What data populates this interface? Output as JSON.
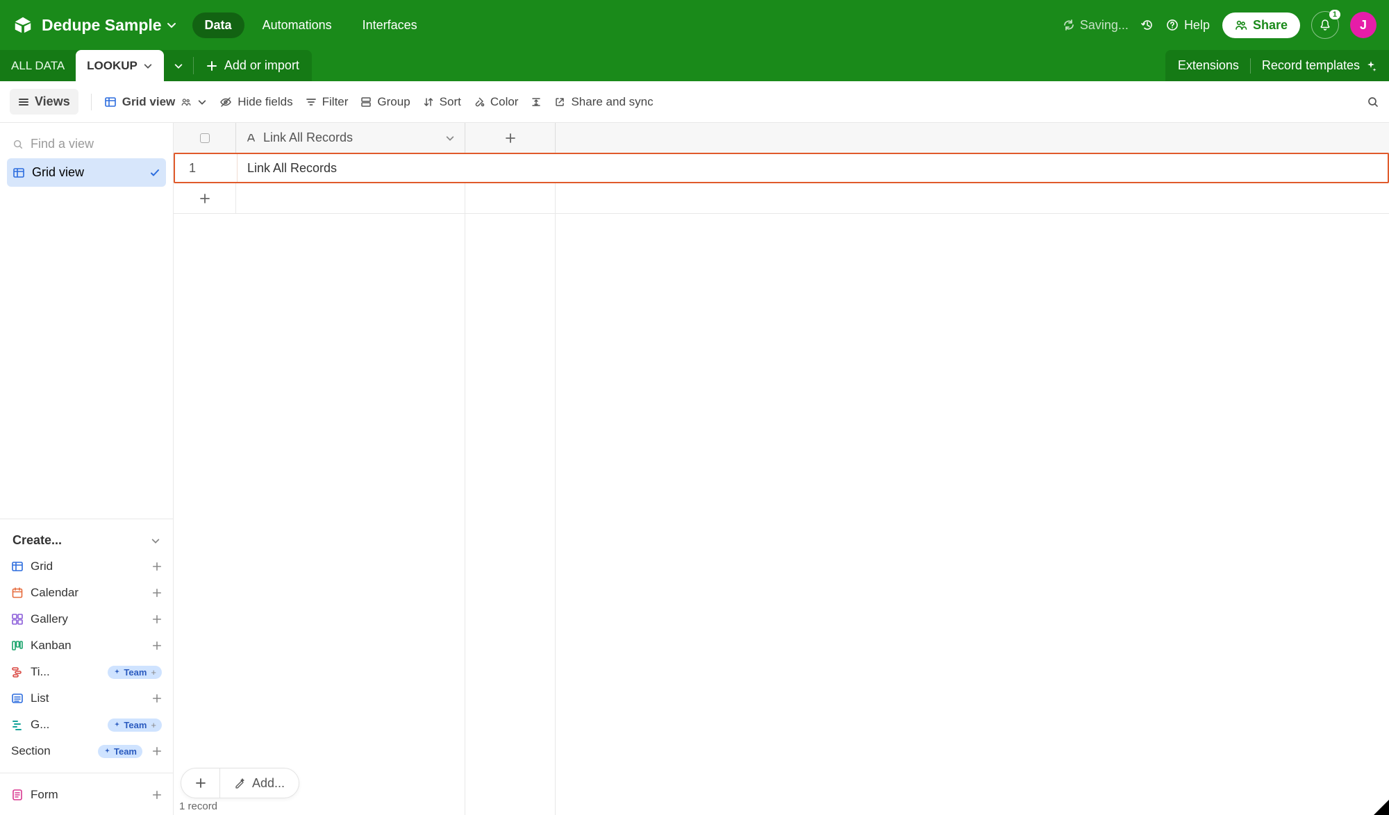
{
  "header": {
    "base_name": "Dedupe Sample",
    "nav": {
      "data": "Data",
      "automations": "Automations",
      "interfaces": "Interfaces"
    },
    "saving": "Saving...",
    "help": "Help",
    "share": "Share",
    "notif_count": "1",
    "avatar_initial": "J"
  },
  "tabs": {
    "items": [
      {
        "label": "ALL DATA"
      },
      {
        "label": "LOOKUP"
      }
    ],
    "add_or_import": "Add or import",
    "extensions": "Extensions",
    "record_templates": "Record templates"
  },
  "toolbar": {
    "views": "Views",
    "grid_view": "Grid view",
    "hide_fields": "Hide fields",
    "filter": "Filter",
    "group": "Group",
    "sort": "Sort",
    "color": "Color",
    "share_sync": "Share and sync"
  },
  "sidebar": {
    "find_placeholder": "Find a view",
    "active_view": "Grid view",
    "create_label": "Create...",
    "types": {
      "grid": "Grid",
      "calendar": "Calendar",
      "gallery": "Gallery",
      "kanban": "Kanban",
      "timeline": "Ti...",
      "list": "List",
      "gantt": "G...",
      "section": "Section",
      "form": "Form"
    },
    "team_badge": "Team"
  },
  "grid": {
    "field_name": "Link All Records",
    "rows": [
      {
        "num": "1",
        "value": "Link All Records"
      }
    ],
    "add_menu": "Add...",
    "status": "1 record"
  },
  "colors": {
    "brand_green": "#1a8a1a",
    "brand_green_dark": "#157a15",
    "highlight_orange": "#e05a2b",
    "avatar_pink": "#e61da8",
    "link_blue": "#2b6cde"
  }
}
